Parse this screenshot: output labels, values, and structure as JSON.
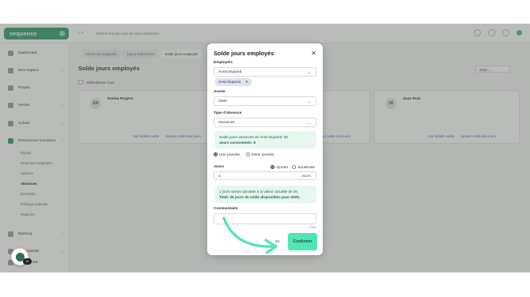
{
  "app": {
    "brand": "sequence"
  },
  "search": {
    "placeholder": "Recherche par nom de dans dispenser"
  },
  "sidebar": {
    "items": [
      {
        "label": "Dashboard"
      },
      {
        "label": "Mon espace"
      },
      {
        "label": "Projets"
      },
      {
        "label": "Ventes"
      },
      {
        "label": "Achats"
      },
      {
        "label": "Ressources humaines"
      }
    ],
    "subitems": [
      "Équipe",
      "Dépenses employés",
      "Salaires",
      "Absences",
      "Entrepôts",
      "Politique salariale",
      "Rapports"
    ],
    "bottom": [
      {
        "label": "Banking"
      },
      {
        "label": "Comptabilité"
      },
      {
        "label": "Intégrations"
      }
    ]
  },
  "main": {
    "tabs": [
      "Absences employés",
      "Types d'absences",
      "Solde jours employés"
    ],
    "title": "Solde jours employés",
    "year": "2025",
    "select_all": "Sélectionner tous",
    "cards": [
      {
        "initials": "ER",
        "name": "Emma Rogers",
        "links": [
          "Voir détails solde",
          "Ajouter solde des jours"
        ]
      },
      {
        "initials": "AD",
        "name": "Anne Dupond",
        "links": [
          "Voir détails solde",
          "Ajouter solde des jours"
        ]
      },
      {
        "initials": "JR",
        "name": "Juan Ruiz",
        "links": [
          "Voir détails solde",
          "Ajouter solde des jours"
        ]
      }
    ]
  },
  "modal": {
    "title": "Solde jours employés",
    "employee_label": "Employé/s",
    "employee_value": "Anne Dupond",
    "chip": "Anne Dupond",
    "year_label": "Année",
    "year_value": "2025",
    "type_label": "Type d'absence",
    "type_value": "Vacances",
    "info1_line1": "Solde jours vacances de Anne Dupond: 25",
    "info1_line2": "Jours consommés: 8",
    "radio_full": "Une journée",
    "radio_half": "Demi journée",
    "days_label": "Jours",
    "add_label": "Ajouter",
    "subtract_label": "Soustraire",
    "days_value": "1",
    "days_unit": "Jours",
    "info2_line1": "1 jours seront ajoutées à la valeur actuelle de 25.",
    "info2_line2": "Total: 26 jours de solde disponibles pour 2025.",
    "comment_label": "Commentaire",
    "counter": "0/300",
    "cancel": "ler",
    "confirm": "Confirmer"
  },
  "badge": {
    "count": "21"
  },
  "colors": {
    "accent": "#2f9c6b",
    "confirm": "#4fe6b4",
    "arrow": "#4fe6b4"
  }
}
